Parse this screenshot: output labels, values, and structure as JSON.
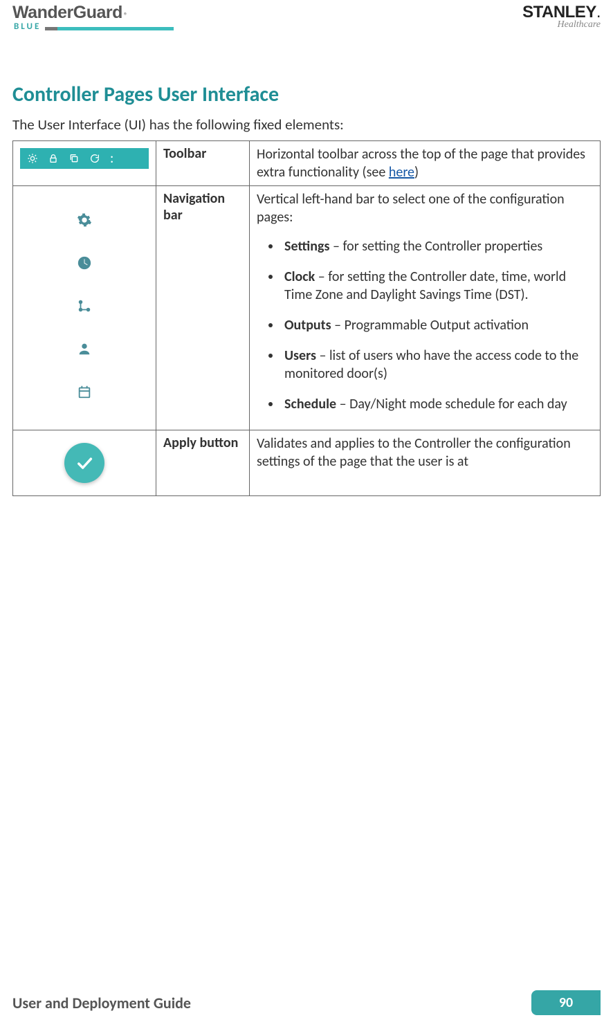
{
  "header": {
    "brand_name": "WanderGuard",
    "brand_sub": "BLUE",
    "company": "STANLEY",
    "company_sub": "Healthcare"
  },
  "section_title": "Controller Pages User Interface",
  "intro": "The User Interface (UI) has the following fixed elements:",
  "rows": {
    "toolbar": {
      "name": "Toolbar",
      "desc_before": "Horizontal toolbar across the top of the page that provides extra functionality (see ",
      "link": "here",
      "desc_after": ")"
    },
    "nav": {
      "name": "Navigation bar",
      "intro": "Vertical left-hand bar to select one of the configuration pages:",
      "items": [
        {
          "label": "Settings",
          "text": " – for setting the Controller properties"
        },
        {
          "label": "Clock",
          "text": " – for setting the Controller date, time, world Time Zone and Daylight Savings Time (DST)."
        },
        {
          "label": "Outputs",
          "text": " – Programmable Output activation"
        },
        {
          "label": "Users",
          "text": " – list of users who have the access code to the monitored door(s)"
        },
        {
          "label": "Schedule",
          "text": " – Day/Night mode schedule for each day"
        }
      ]
    },
    "apply": {
      "name": "Apply button",
      "desc": "Validates and applies to the Controller the configuration settings of the page that the user is at"
    }
  },
  "footer": {
    "title": "User and Deployment Guide",
    "page": "90"
  }
}
